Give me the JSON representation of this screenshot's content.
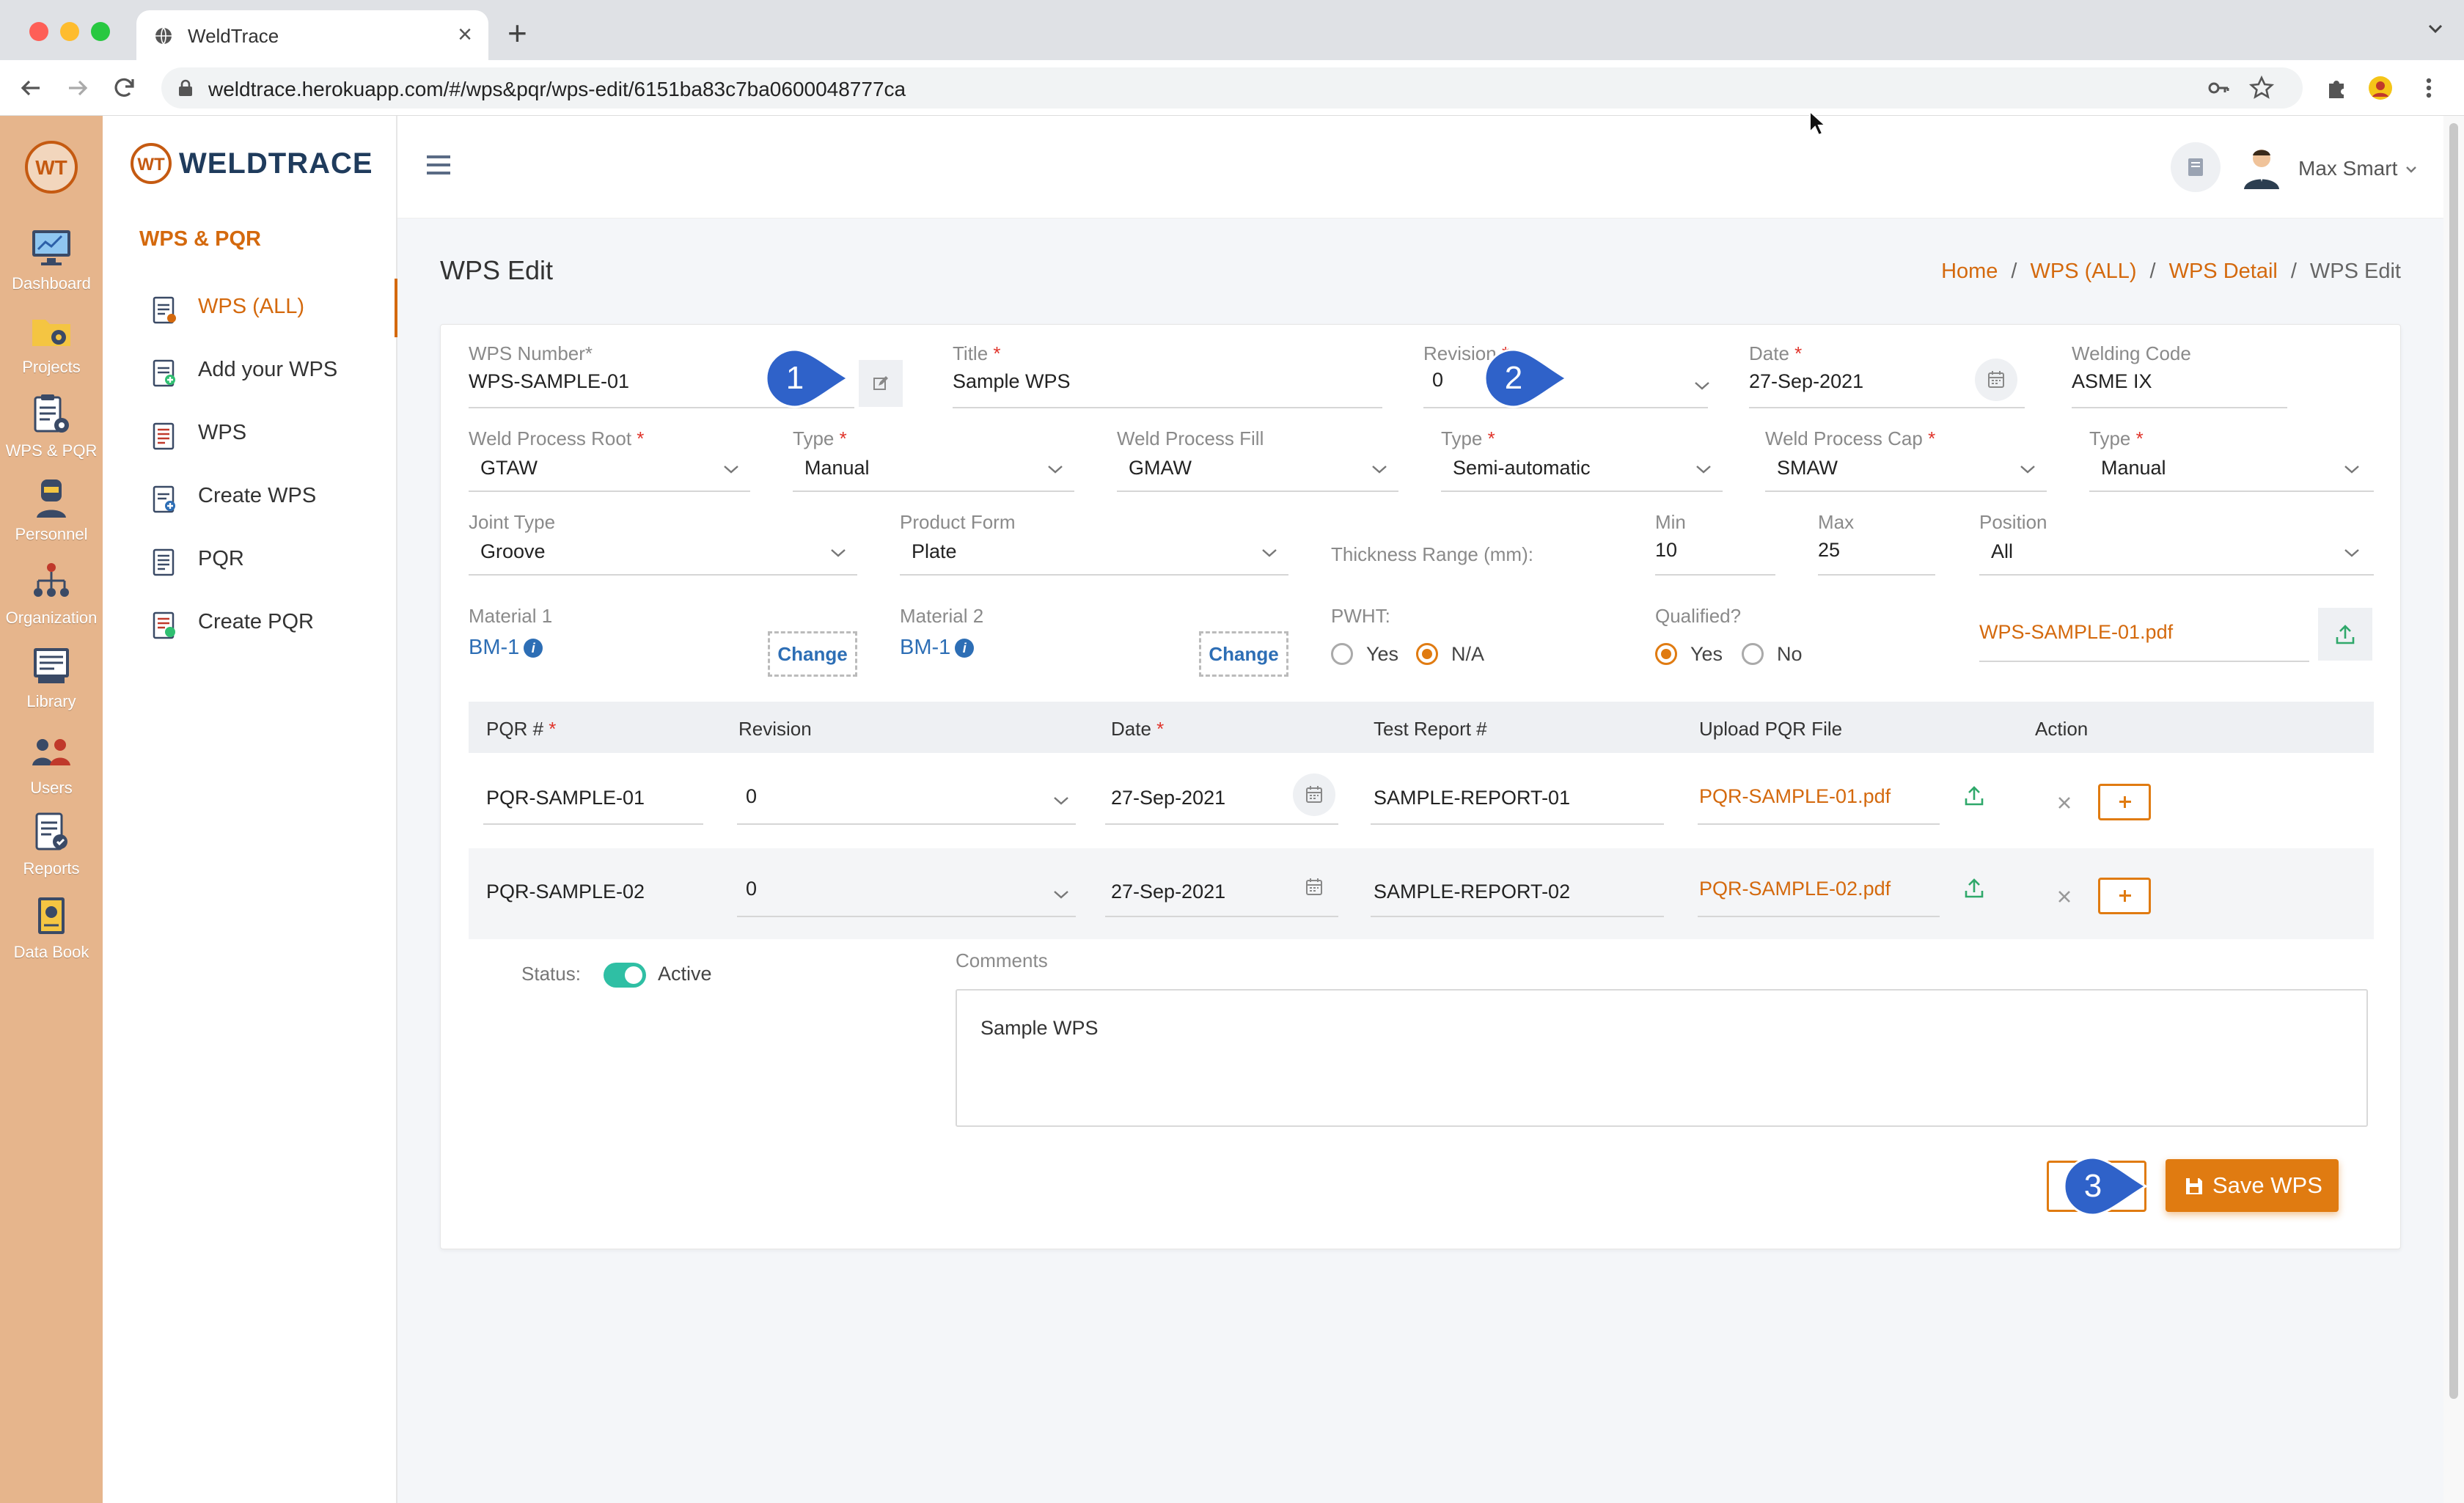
{
  "browser": {
    "tab_title": "WeldTrace",
    "url": "weldtrace.herokuapp.com/#/wps&pqr/wps-edit/6151ba83c7ba0600048777ca"
  },
  "rail": {
    "logo": "WT",
    "items": [
      {
        "label": "Dashboard",
        "icon": "monitor-icon"
      },
      {
        "label": "Projects",
        "icon": "folder-icon"
      },
      {
        "label": "WPS & PQR",
        "icon": "clipboard-gear-icon"
      },
      {
        "label": "Personnel",
        "icon": "welder-icon"
      },
      {
        "label": "Organization",
        "icon": "org-icon"
      },
      {
        "label": "Library",
        "icon": "library-icon"
      },
      {
        "label": "Users",
        "icon": "users-icon"
      },
      {
        "label": "Reports",
        "icon": "reports-icon"
      },
      {
        "label": "Data Book",
        "icon": "data-book-icon"
      }
    ]
  },
  "sidebar": {
    "brand": "WELDTRACE",
    "brand_mark": "WT",
    "section": "WPS & PQR",
    "items": [
      {
        "label": "WPS (ALL)",
        "active": true
      },
      {
        "label": "Add your WPS"
      },
      {
        "label": "WPS"
      },
      {
        "label": "Create WPS"
      },
      {
        "label": "PQR"
      },
      {
        "label": "Create PQR"
      }
    ]
  },
  "topbar": {
    "user_name": "Max Smart"
  },
  "page": {
    "title": "WPS Edit",
    "breadcrumb": [
      "Home",
      "WPS (ALL)",
      "WPS Detail",
      "WPS Edit"
    ]
  },
  "form": {
    "wps_number": {
      "label": "WPS Number*",
      "value": "WPS-SAMPLE-01"
    },
    "title": {
      "label": "Title",
      "value": "Sample WPS"
    },
    "revision": {
      "label": "Revision",
      "value": "0"
    },
    "date": {
      "label": "Date",
      "value": "27-Sep-2021"
    },
    "welding_code": {
      "label": "Welding Code",
      "value": "ASME IX"
    },
    "weld_process_root": {
      "label": "Weld Process Root",
      "value": "GTAW"
    },
    "root_type": {
      "label": "Type",
      "value": "Manual"
    },
    "weld_process_fill": {
      "label": "Weld Process Fill",
      "value": "GMAW"
    },
    "fill_type": {
      "label": "Type",
      "value": "Semi-automatic"
    },
    "weld_process_cap": {
      "label": "Weld Process Cap",
      "value": "SMAW"
    },
    "cap_type": {
      "label": "Type",
      "value": "Manual"
    },
    "joint_type": {
      "label": "Joint Type",
      "value": "Groove"
    },
    "product_form": {
      "label": "Product Form",
      "value": "Plate"
    },
    "thickness_range": {
      "label": "Thickness Range (mm):",
      "min_label": "Min",
      "min": "10",
      "max_label": "Max",
      "max": "25"
    },
    "position": {
      "label": "Position",
      "value": "All"
    },
    "material1": {
      "label": "Material 1",
      "value": "BM-1",
      "change_label": "Change"
    },
    "material2": {
      "label": "Material 2",
      "value": "BM-1",
      "change_label": "Change"
    },
    "pwht": {
      "label": "PWHT:",
      "options": [
        "Yes",
        "N/A"
      ],
      "selected": "N/A"
    },
    "qualified": {
      "label": "Qualified?",
      "options": [
        "Yes",
        "No"
      ],
      "selected": "Yes"
    },
    "wps_file": "WPS-SAMPLE-01.pdf"
  },
  "pqr_table": {
    "headers": [
      "PQR #",
      "Revision",
      "Date",
      "Test Report #",
      "Upload PQR File",
      "Action"
    ],
    "rows": [
      {
        "pqr": "PQR-SAMPLE-01",
        "revision": "0",
        "date": "27-Sep-2021",
        "report": "SAMPLE-REPORT-01",
        "file": "PQR-SAMPLE-01.pdf"
      },
      {
        "pqr": "PQR-SAMPLE-02",
        "revision": "0",
        "date": "27-Sep-2021",
        "report": "SAMPLE-REPORT-02",
        "file": "PQR-SAMPLE-02.pdf"
      }
    ]
  },
  "status": {
    "label": "Status:",
    "value": "Active",
    "enabled": true
  },
  "comments": {
    "label": "Comments",
    "value": "Sample WPS"
  },
  "actions": {
    "save_label": "Save WPS"
  },
  "markers": [
    "1",
    "2",
    "3"
  ],
  "colors": {
    "accent": "#e07b11",
    "link": "#2d6eb5",
    "rail": "#e6b58c",
    "marker": "#2f62c9"
  }
}
